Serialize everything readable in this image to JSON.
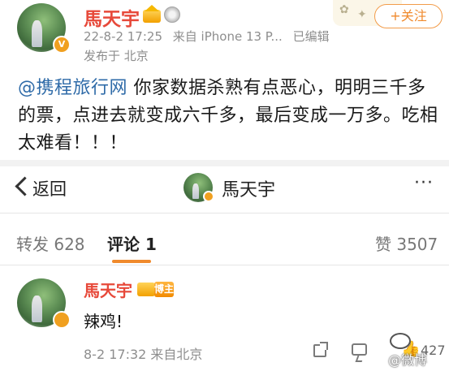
{
  "post": {
    "author_name": "馬天宇",
    "timestamp": "22-8-2 17:25",
    "source": "来自 iPhone 13 P...",
    "edited_label": "已编辑",
    "location": "发布于 北京",
    "follow_label": "+关注",
    "mention": "@携程旅行网",
    "text": " 你家数据杀熟有点恶心，明明三千多的票，点进去就变成六千多，最后变成一万多。吃相太难看！！！",
    "vip_badge": "V"
  },
  "navbar": {
    "back_label": "返回",
    "title": "馬天宇",
    "more_icon": "···"
  },
  "tabs": [
    {
      "label": "转发 628",
      "active": false
    },
    {
      "label": "评论 1",
      "active": true
    },
    {
      "label": "赞 3507",
      "active": false
    }
  ],
  "comment": {
    "author_name": "馬天宇",
    "badge": "博主",
    "text": "辣鸡!",
    "meta": "8-2 17:32 来自北京",
    "like_count": "427"
  },
  "watermark": {
    "text": "@微博"
  },
  "icons": {
    "share": "share-icon",
    "comment": "comment-icon",
    "like": "thumbs-up-icon",
    "back": "chevron-left-icon",
    "more": "more-dots-icon"
  },
  "colors": {
    "name_red": "#e7493a",
    "accent_orange": "#f08a2c",
    "mention_blue": "#2f6ba8"
  }
}
